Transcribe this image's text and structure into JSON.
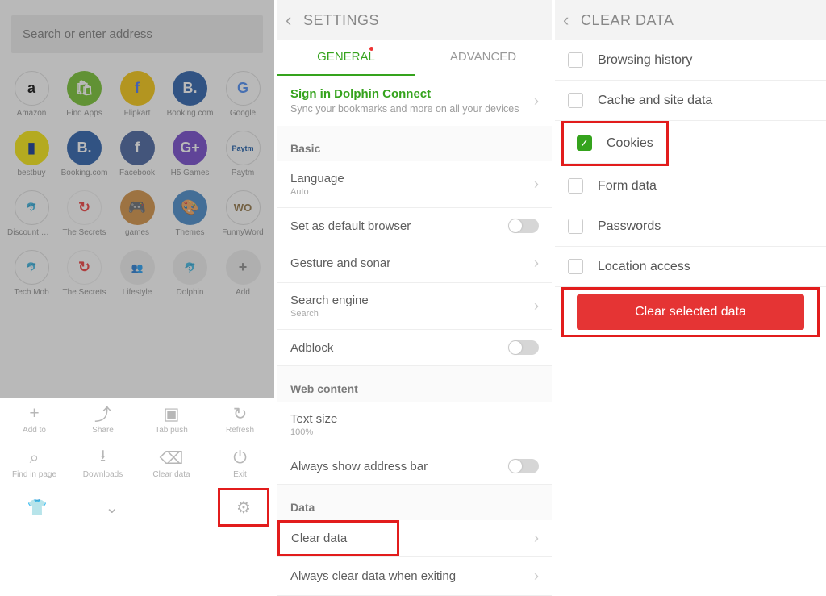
{
  "panel1": {
    "search_placeholder": "Search or enter address",
    "speeddial": [
      [
        {
          "label": "Amazon",
          "bg": "#fff",
          "txt": "a",
          "fg": "#000",
          "border": "1px solid #ddd"
        },
        {
          "label": "Find Apps",
          "bg": "#6DBE23",
          "txt": "🛍",
          "fg": "#fff"
        },
        {
          "label": "Flipkart",
          "bg": "#F6C300",
          "txt": "f",
          "fg": "#3b6df3"
        },
        {
          "label": "Booking.com",
          "bg": "#1D56A6",
          "txt": "B.",
          "fg": "#fff"
        },
        {
          "label": "Google",
          "bg": "#fff",
          "txt": "G",
          "fg": "#4285F4",
          "border": "1px solid #ddd"
        }
      ],
      [
        {
          "label": "bestbuy",
          "bg": "#F7E600",
          "txt": "▮",
          "fg": "#002b8c"
        },
        {
          "label": "Booking.com",
          "bg": "#1D56A6",
          "txt": "B.",
          "fg": "#fff"
        },
        {
          "label": "Facebook",
          "bg": "#3B5998",
          "txt": "f",
          "fg": "#fff"
        },
        {
          "label": "H5 Games",
          "bg": "#6B3DC9",
          "txt": "G+",
          "fg": "#fff"
        },
        {
          "label": "Paytm",
          "bg": "#fff",
          "txt": "Paytm",
          "fg": "#0A4FA1",
          "border": "1px solid #ddd",
          "fs": "9px"
        }
      ],
      [
        {
          "label": "Discount Mall",
          "bg": "#fff",
          "txt": "🐬",
          "fg": "#35a31d",
          "border": "1px solid #ddd",
          "fs": "11px"
        },
        {
          "label": "The Secrets",
          "bg": "#fff",
          "txt": "↻",
          "fg": "#e33",
          "border": "1px solid #eee"
        },
        {
          "label": "games",
          "bg": "#d08a3a",
          "txt": "🎮",
          "fg": "#fff"
        },
        {
          "label": "Themes",
          "bg": "#3b82c7",
          "txt": "🎨",
          "fg": "#fff"
        },
        {
          "label": "FunnyWord",
          "bg": "#fff",
          "txt": "WO",
          "fg": "#8a6b3a",
          "border": "1px solid #ddd",
          "fs": "13px"
        }
      ],
      [
        {
          "label": "Tech Mob",
          "bg": "#fff",
          "txt": "🐬",
          "fg": "#35a31d",
          "border": "1px solid #ddd",
          "fs": "11px"
        },
        {
          "label": "The Secrets",
          "bg": "#fff",
          "txt": "↻",
          "fg": "#e33",
          "border": "1px solid #eee"
        },
        {
          "label": "Lifestyle",
          "bg": "#eee",
          "txt": "👥",
          "fg": "#555",
          "fs": "12px"
        },
        {
          "label": "Dolphin",
          "bg": "#eee",
          "txt": "🐬",
          "fg": "#35a31d",
          "fs": "12px"
        },
        {
          "label": "Add",
          "bg": "#eee",
          "txt": "+",
          "fg": "#888"
        }
      ]
    ],
    "tray": [
      {
        "icon": "+",
        "label": "Add to"
      },
      {
        "icon": "⤴",
        "label": "Share"
      },
      {
        "icon": "▣",
        "label": "Tab push"
      },
      {
        "icon": "↻",
        "label": "Refresh"
      },
      {
        "icon": "⌕",
        "label": "Find in page"
      },
      {
        "icon": "⭳",
        "label": "Downloads"
      },
      {
        "icon": "⌫",
        "label": "Clear data"
      },
      {
        "icon": "⏻",
        "label": "Exit"
      }
    ],
    "tray_bottom": {
      "left": "👕",
      "mid": "⌄",
      "right": "⚙"
    }
  },
  "panel2": {
    "title": "SETTINGS",
    "tabs": {
      "general": "GENERAL",
      "advanced": "ADVANCED"
    },
    "signin": {
      "title": "Sign in Dolphin Connect",
      "sub": "Sync your bookmarks and more on all your devices"
    },
    "basic_head": "Basic",
    "rows_basic": [
      {
        "label": "Language",
        "sub": "Auto",
        "aff": "chev"
      },
      {
        "label": "Set as default browser",
        "aff": "toggle"
      },
      {
        "label": "Gesture and sonar",
        "aff": "chev"
      },
      {
        "label": "Search engine",
        "sub": "Search",
        "aff": "chev"
      },
      {
        "label": "Adblock",
        "aff": "toggle"
      }
    ],
    "web_head": "Web content",
    "rows_web": [
      {
        "label": "Text size",
        "sub": "100%",
        "aff": "none"
      },
      {
        "label": "Always show address bar",
        "aff": "toggle"
      }
    ],
    "data_head": "Data",
    "rows_data": [
      {
        "label": "Clear data",
        "aff": "chev",
        "hl": true
      },
      {
        "label": "Always clear data when exiting",
        "aff": "chev"
      }
    ]
  },
  "panel3": {
    "title": "CLEAR DATA",
    "items": [
      {
        "label": "Browsing history",
        "checked": false
      },
      {
        "label": "Cache and site data",
        "checked": false
      },
      {
        "label": "Cookies",
        "checked": true,
        "hl": true
      },
      {
        "label": "Form data",
        "checked": false
      },
      {
        "label": "Passwords",
        "checked": false
      },
      {
        "label": "Location access",
        "checked": false
      }
    ],
    "button": "Clear selected data"
  }
}
